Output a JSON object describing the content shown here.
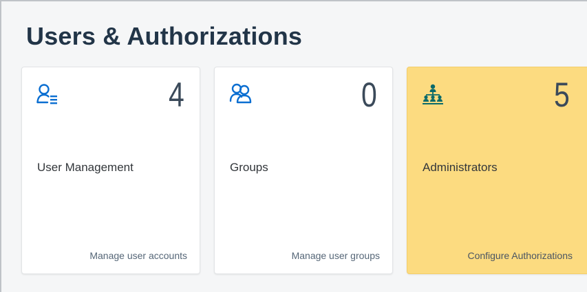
{
  "page": {
    "title": "Users & Authorizations"
  },
  "tiles": [
    {
      "icon": "user-list-icon",
      "count": "4",
      "title": "User Management",
      "footer": "Manage user accounts",
      "background": "#ffffff"
    },
    {
      "icon": "user-group-icon",
      "count": "0",
      "title": "Groups",
      "footer": "Manage user groups",
      "background": "#ffffff"
    },
    {
      "icon": "hierarchy-icon",
      "count": "5",
      "title": "Administrators",
      "footer": "Configure Authorizations",
      "background": "#fcdb80"
    }
  ],
  "colors": {
    "icon_blue": "#0a6ed1",
    "icon_teal": "#0a6a6a",
    "title_text": "#223548",
    "highlight_tile": "#fcdb80"
  }
}
